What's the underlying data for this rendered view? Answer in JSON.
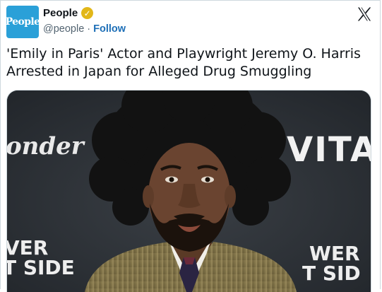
{
  "account": {
    "avatar_text": "People",
    "name": "People",
    "handle": "@people",
    "separator": "·",
    "follow_label": "Follow"
  },
  "post": {
    "headline": "'Emily in Paris' Actor and Playwright Jeremy O. Harris Arrested in Japan for Alleged Drug Smuggling"
  },
  "photo": {
    "backdrop_left_text": "onder",
    "backdrop_right_text": "VITA",
    "backdrop_bottom_left_line1": "VER",
    "backdrop_bottom_left_line2": "T SIDE",
    "backdrop_bottom_right_line1": "WER",
    "backdrop_bottom_right_line2": "T SID"
  },
  "icons": {
    "verified": "verified-badge-icon",
    "platform": "x-logo-icon"
  },
  "colors": {
    "avatar_bg": "#2aa0d8",
    "verified_gold": "#e2b719",
    "follow_blue": "#1d6fb7",
    "text_primary": "#0f1419",
    "text_secondary": "#536471"
  }
}
